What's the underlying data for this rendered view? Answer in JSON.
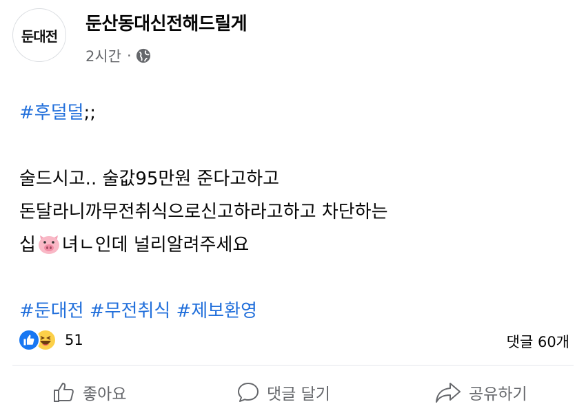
{
  "page": {
    "avatar_text": "둔대전",
    "name": "둔산동대신전해드릴게",
    "time": "2시간",
    "separator": "·",
    "privacy_icon": "globe-icon"
  },
  "post": {
    "tag_top": "#후덜덜",
    "tag_top_suffix": ";;",
    "line1": "술드시고.. 술값95만원 준다고하고",
    "line2": "돈달라니까무전취식으로신고하라고하고 차단하는",
    "line3_before": "십",
    "line3_emoji": "pig-face-emoji",
    "line3_after": "녀ㄴ인데 널리알려주세요",
    "tags": [
      "#둔대전",
      "#무전취식",
      "#제보환영"
    ]
  },
  "reactions": {
    "icons": [
      "like-icon",
      "haha-icon"
    ],
    "count": "51",
    "comments": "댓글 60개"
  },
  "actions": {
    "like": "좋아요",
    "comment": "댓글 달기",
    "share": "공유하기"
  },
  "colors": {
    "hashtag": "#216fdb",
    "like_blue": "#1877f2",
    "secondary_text": "#65676b",
    "haha_yellow": "#fcd049"
  }
}
